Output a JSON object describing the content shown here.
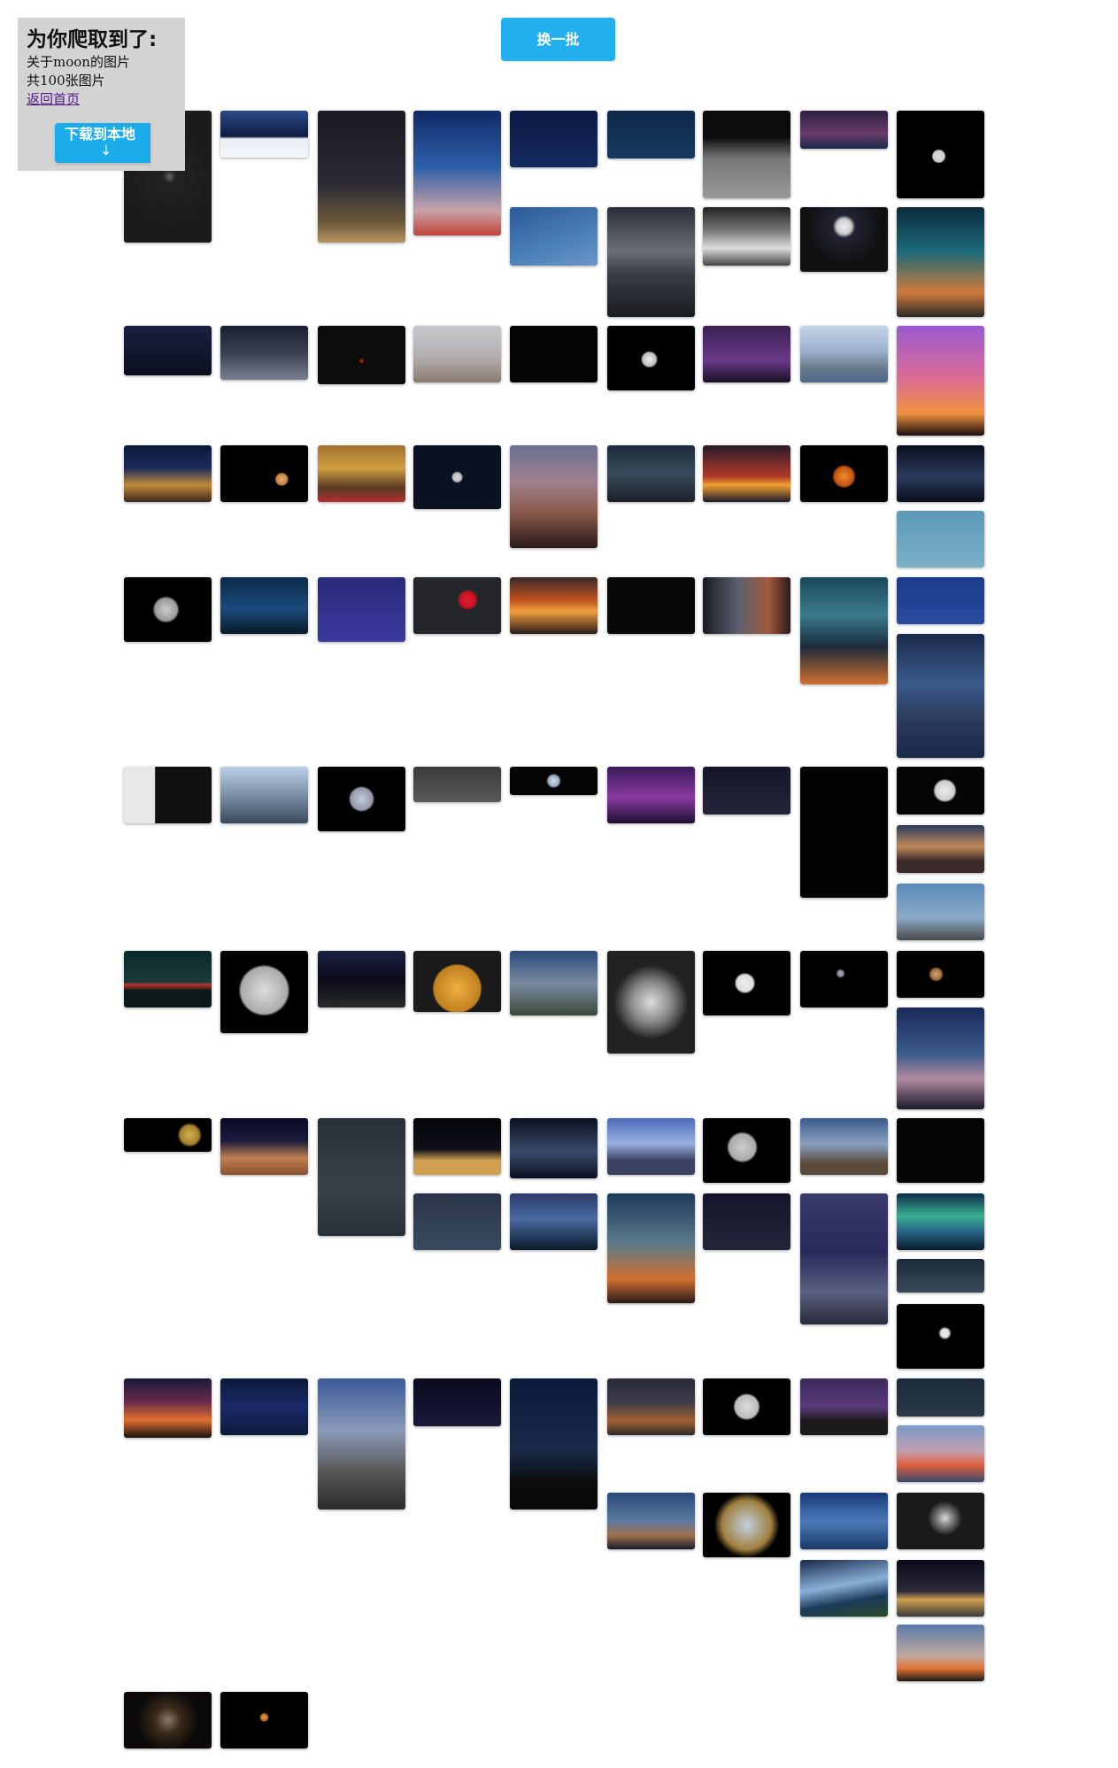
{
  "panel": {
    "title": "为你爬取到了:",
    "keyword_line": "关于moon的图片",
    "count_line": "共100张图片",
    "home_link": "返回首页",
    "download_label": "下载到本地",
    "download_arrow": "↓"
  },
  "toolbar": {
    "refresh_label": "换一批"
  },
  "colors": {
    "accent": "#22b1ee",
    "panel_bg": "#d3d3d3",
    "link": "#551a8b"
  }
}
